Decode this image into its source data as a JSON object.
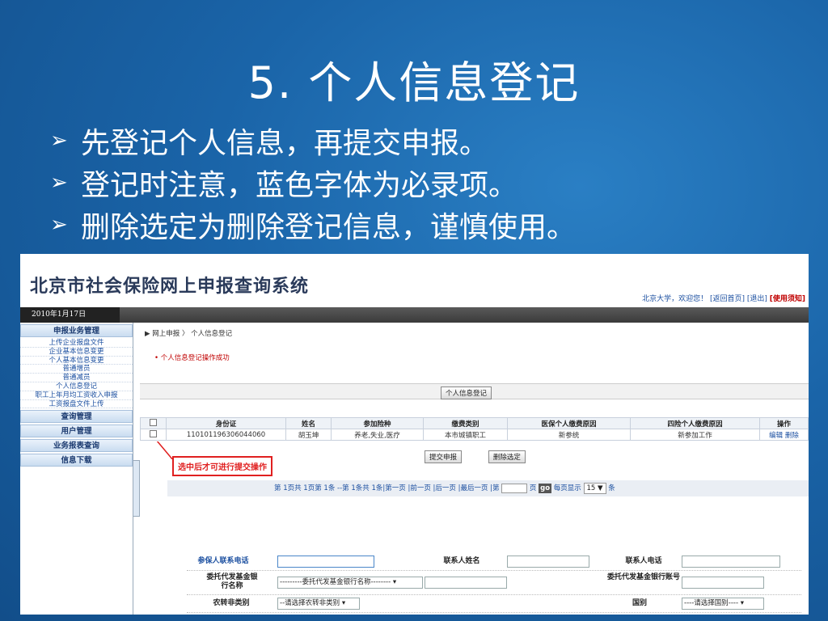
{
  "slide": {
    "title": "5. 个人信息登记",
    "bullets": [
      "先登记个人信息，再提交申报。",
      "登记时注意，蓝色字体为必录项。",
      "删除选定为删除登记信息，谨慎使用。"
    ]
  },
  "app": {
    "title": "北京市社会保险网上申报查询系统",
    "header_user": "北京大学，欢迎您！",
    "header_home": "[返回首页]",
    "header_logout": "[退出]",
    "header_notice": "[使用须知]",
    "date": "2010年1月17日"
  },
  "sidebar": {
    "section1": "申报业务管理",
    "items": [
      "上传企业报盘文件",
      "企业基本信息变更",
      "个人基本信息变更",
      "普通增员",
      "普通减员",
      "个人信息登记",
      "职工上年月均工资收入申报",
      "工资报盘文件上传"
    ],
    "section2": "查询管理",
    "section3": "用户管理",
    "section4": "业务报表查询",
    "section5": "信息下载"
  },
  "main": {
    "crumb_arrow": "▶",
    "crumb": "网上申报 〉 个人信息登记",
    "success": "•  个人信息登记操作成功",
    "register_button": "个人信息登记",
    "table": {
      "headers": [
        "身份证",
        "姓名",
        "参加险种",
        "缴费类别",
        "医保个人缴费原因",
        "四险个人缴费原因",
        "操作"
      ],
      "row": {
        "id": "110101196306044060",
        "name": "胡玉坤",
        "insurance": "养老,失业,医疗",
        "category": "本市城镇职工",
        "med_reason": "新参统",
        "four_reason": "新参加工作",
        "edit": "编辑",
        "delete": "删除"
      }
    },
    "submit_button": "提交申报",
    "delete_selected_button": "删除选定",
    "callout": "选中后才可进行提交操作",
    "pager": {
      "text": "第 1页共 1页第 1条 --第 1条共 1条|第一页 |前一页 |后一页 |最后一页 |第",
      "page_suffix": "页",
      "go": "go",
      "per_page_label": "每页显示",
      "per_page_value": "15 ▼",
      "per_page_unit": "条"
    },
    "form": {
      "phone_label": "参保人联系电话",
      "contact_name_label": "联系人姓名",
      "contact_phone_label": "联系人电话",
      "bank_name_label": "委托代发基金银行名称",
      "bank_select": "---------委托代发基金银行名称--------  ▾",
      "bank_account_label": "委托代发基金银行账号",
      "transfer_label": "农转非类别",
      "transfer_select": "--请选择农转非类别 ▾",
      "country_label": "国别",
      "country_select": "----请选择国别----   ▾"
    }
  },
  "colors": {
    "slide_bg": "#1a64a8",
    "accent_red": "#e02020",
    "link_blue": "#1b4fa0"
  }
}
